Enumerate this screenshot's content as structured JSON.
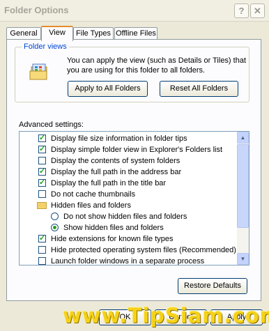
{
  "window": {
    "title": "Folder Options",
    "help_label": "?",
    "close_label": "✕"
  },
  "tabs": [
    {
      "label": "General"
    },
    {
      "label": "View"
    },
    {
      "label": "File Types"
    },
    {
      "label": "Offline Files"
    }
  ],
  "folder_views": {
    "label": "Folder views",
    "description": "You can apply the view (such as Details or Tiles) that you are using for this folder to all folders.",
    "apply_button": "Apply to All Folders",
    "reset_button": "Reset All Folders"
  },
  "advanced": {
    "label": "Advanced settings:",
    "items": [
      {
        "type": "checkbox",
        "checked": true,
        "label": "Display file size information in folder tips"
      },
      {
        "type": "checkbox",
        "checked": true,
        "label": "Display simple folder view in Explorer's Folders list"
      },
      {
        "type": "checkbox",
        "checked": false,
        "label": "Display the contents of system folders"
      },
      {
        "type": "checkbox",
        "checked": true,
        "label": "Display the full path in the address bar"
      },
      {
        "type": "checkbox",
        "checked": true,
        "label": "Display the full path in the title bar"
      },
      {
        "type": "checkbox",
        "checked": false,
        "label": "Do not cache thumbnails"
      },
      {
        "type": "folder",
        "label": "Hidden files and folders"
      },
      {
        "type": "radio",
        "checked": false,
        "label": "Do not show hidden files and folders"
      },
      {
        "type": "radio",
        "checked": true,
        "label": "Show hidden files and folders"
      },
      {
        "type": "checkbox",
        "checked": true,
        "label": "Hide extensions for known file types"
      },
      {
        "type": "checkbox",
        "checked": false,
        "label": "Hide protected operating system files (Recommended)"
      },
      {
        "type": "checkbox",
        "checked": false,
        "label": "Launch folder windows in a separate process"
      }
    ]
  },
  "restore_button": "Restore Defaults",
  "footer": {
    "ok": "OK",
    "cancel": "Cancel",
    "apply": "Apply"
  },
  "watermark": "www.TipSiam.com"
}
